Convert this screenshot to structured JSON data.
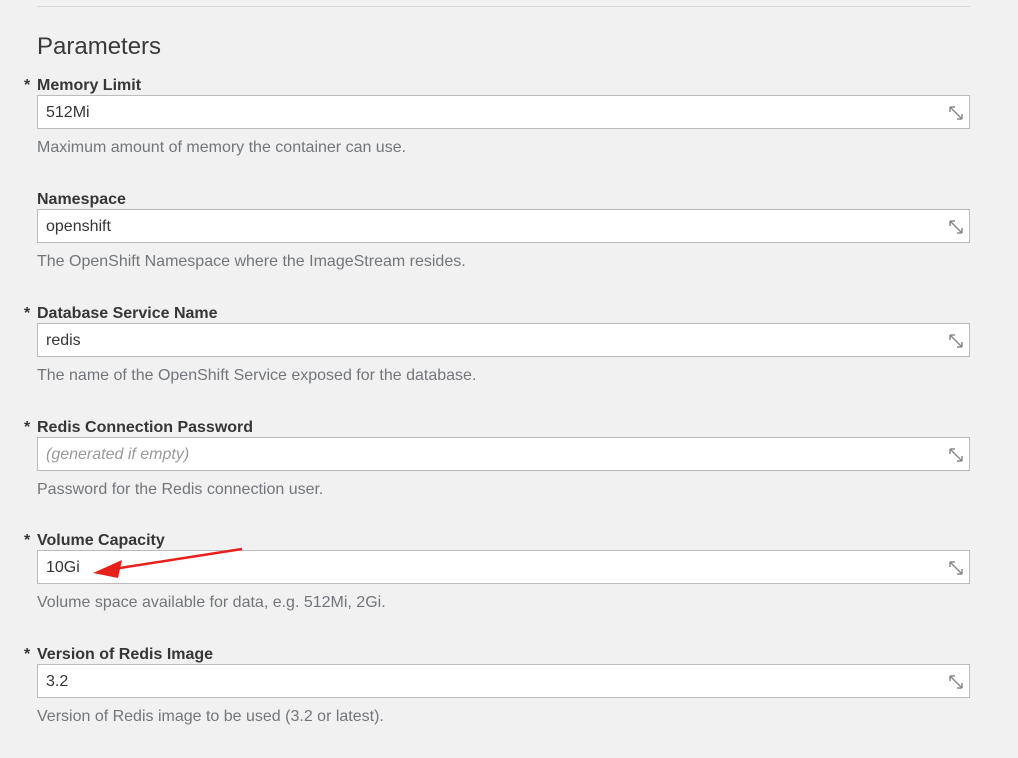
{
  "section": {
    "title": "Parameters"
  },
  "params": [
    {
      "label": "Memory Limit",
      "required_mark": "*",
      "value": "512Mi",
      "placeholder": "",
      "help": "Maximum amount of memory the container can use."
    },
    {
      "label": "Namespace",
      "required_mark": "",
      "value": "openshift",
      "placeholder": "",
      "help": "The OpenShift Namespace where the ImageStream resides."
    },
    {
      "label": "Database Service Name",
      "required_mark": "*",
      "value": "redis",
      "placeholder": "",
      "help": "The name of the OpenShift Service exposed for the database."
    },
    {
      "label": "Redis Connection Password",
      "required_mark": "*",
      "value": "",
      "placeholder": "(generated if empty)",
      "help": "Password for the Redis connection user."
    },
    {
      "label": "Volume Capacity",
      "required_mark": "*",
      "value": "10Gi",
      "placeholder": "",
      "help": "Volume space available for data, e.g. 512Mi, 2Gi."
    },
    {
      "label": "Version of Redis Image",
      "required_mark": "*",
      "value": "3.2",
      "placeholder": "",
      "help": "Version of Redis image to be used (3.2 or latest)."
    }
  ],
  "icons": {
    "resize": "expand-diagonal-icon",
    "annotation": "red-arrow"
  },
  "colors": {
    "background": "#f1f1f1",
    "input_border": "#bbbbbb",
    "help_text": "#72767b",
    "annotation_arrow": "#e8201c"
  }
}
